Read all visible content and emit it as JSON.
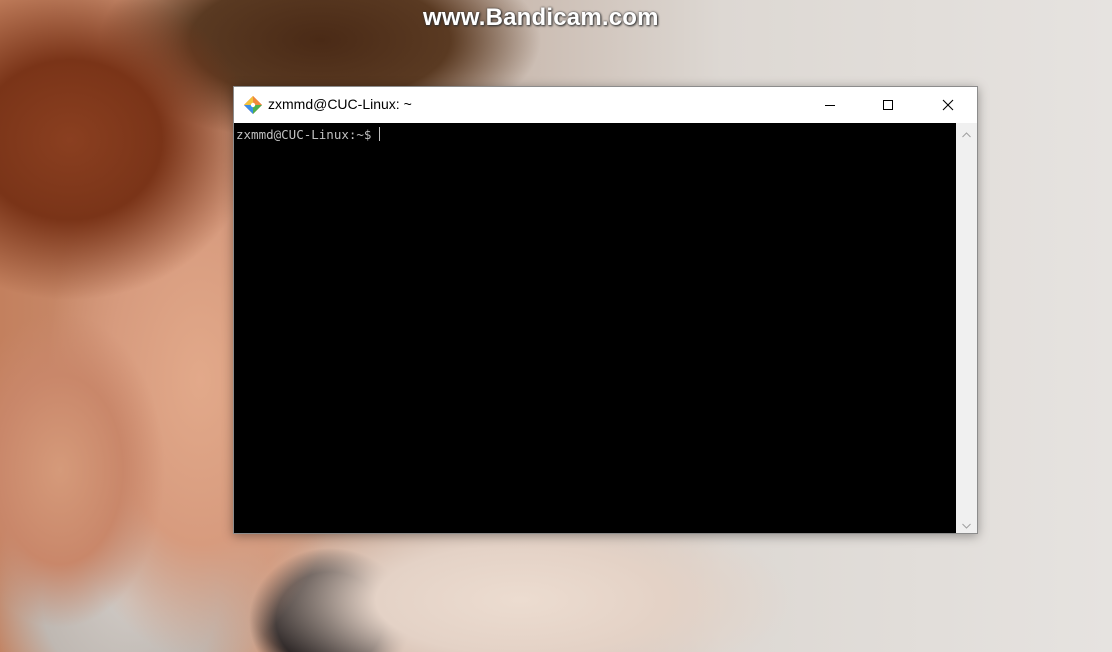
{
  "watermark": "www.Bandicam.com",
  "window": {
    "title": "zxmmd@CUC-Linux: ~",
    "app_icon": "git-bash-icon",
    "controls": {
      "minimize": "minimize-icon",
      "maximize": "maximize-icon",
      "close": "close-icon"
    }
  },
  "terminal": {
    "prompt": "zxmmd@CUC-Linux:~$",
    "input": "",
    "background": "#000000",
    "foreground": "#c0c0c0"
  },
  "scrollbar": {
    "up_icon": "scroll-up-arrow-icon",
    "down_icon": "scroll-down-arrow-icon"
  }
}
